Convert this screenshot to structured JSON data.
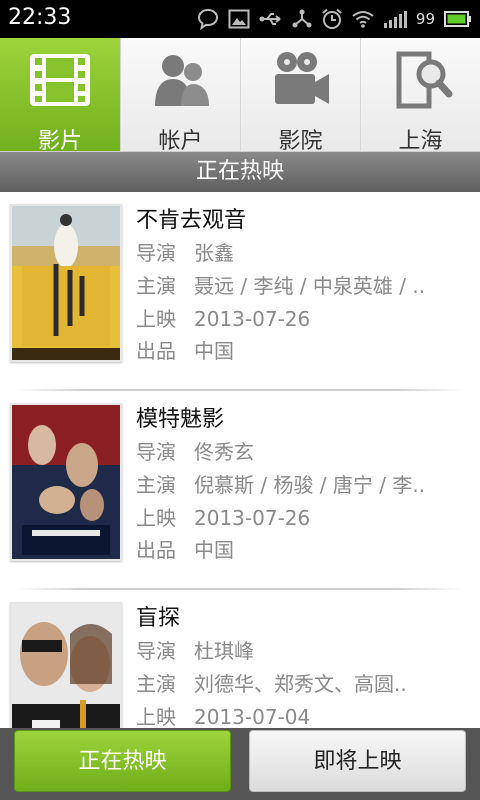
{
  "status_bar": {
    "time": "22:33",
    "battery_percent": "99",
    "icons": [
      "chat-bubble-icon",
      "image-icon",
      "usb-icon",
      "share-icon",
      "alarm-icon",
      "wifi-icon",
      "signal-icon",
      "battery-icon"
    ]
  },
  "tabs": [
    {
      "label": "影片",
      "icon": "film-icon",
      "active": true
    },
    {
      "label": "帐户",
      "icon": "account-icon",
      "active": false
    },
    {
      "label": "影院",
      "icon": "cinema-camera-icon",
      "active": false
    },
    {
      "label": "上海",
      "icon": "location-search-icon",
      "active": false
    }
  ],
  "section_title": "正在热映",
  "movies": [
    {
      "title": "不肯去观音",
      "director_label": "导演",
      "director": "张鑫",
      "cast_label": "主演",
      "cast": "聂远 / 李纯 / 中泉英雄 / ..",
      "release_label": "上映",
      "release": "2013-07-26",
      "origin_label": "出品",
      "origin": "中国"
    },
    {
      "title": "模特魅影",
      "director_label": "导演",
      "director": "佟秀玄",
      "cast_label": "主演",
      "cast": "倪慕斯 / 杨骏 / 唐宁 / 李..",
      "release_label": "上映",
      "release": "2013-07-26",
      "origin_label": "出品",
      "origin": "中国"
    },
    {
      "title": "盲探",
      "director_label": "导演",
      "director": "杜琪峰",
      "cast_label": "主演",
      "cast": "刘德华、郑秀文、高圆..",
      "release_label": "上映",
      "release": "2013-07-04"
    }
  ],
  "bottom_buttons": {
    "now_showing": "正在热映",
    "coming_soon": "即将上映"
  },
  "colors": {
    "accent_green": "#7dbd25",
    "header_gray": "#6e6e6e",
    "info_gray": "#8a8a8a"
  }
}
